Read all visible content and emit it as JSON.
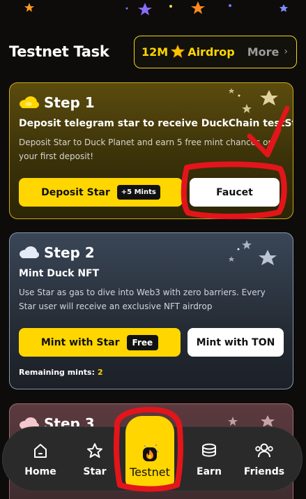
{
  "header": {
    "title": "Testnet Task",
    "airdrop_amount": "12M",
    "airdrop_label": "Airdrop",
    "more_label": "More"
  },
  "steps": [
    {
      "title": "Step 1",
      "task": "Deposit telegram star to receive DuckChain testSta",
      "description": "Deposit Star to Duck Planet and earn 5 free mint chances on your first deposit!",
      "primary_button": "Deposit Star",
      "primary_badge": "+5 Mints",
      "secondary_button": "Faucet"
    },
    {
      "title": "Step 2",
      "task": "Mint Duck NFT",
      "description": "Use Star as gas to dive into Web3 with zero barriers. Every Star user will receive an exclusive NFT airdrop",
      "primary_button": "Mint with Star",
      "primary_badge": "Free",
      "secondary_button": "Mint with TON",
      "remaining_label": "Remaining mints:",
      "remaining_value": "2"
    },
    {
      "title": "Step 3"
    }
  ],
  "nav": {
    "items": [
      {
        "label": "Home",
        "icon": "home-icon"
      },
      {
        "label": "Star",
        "icon": "star-outline-icon"
      },
      {
        "label": "Testnet",
        "icon": "flame-icon"
      },
      {
        "label": "Earn",
        "icon": "coins-icon"
      },
      {
        "label": "Friends",
        "icon": "friends-icon"
      }
    ],
    "active": "Testnet"
  },
  "colors": {
    "accent": "#ffd600",
    "annotation": "#e3151b",
    "background": "#0d0c0a"
  }
}
